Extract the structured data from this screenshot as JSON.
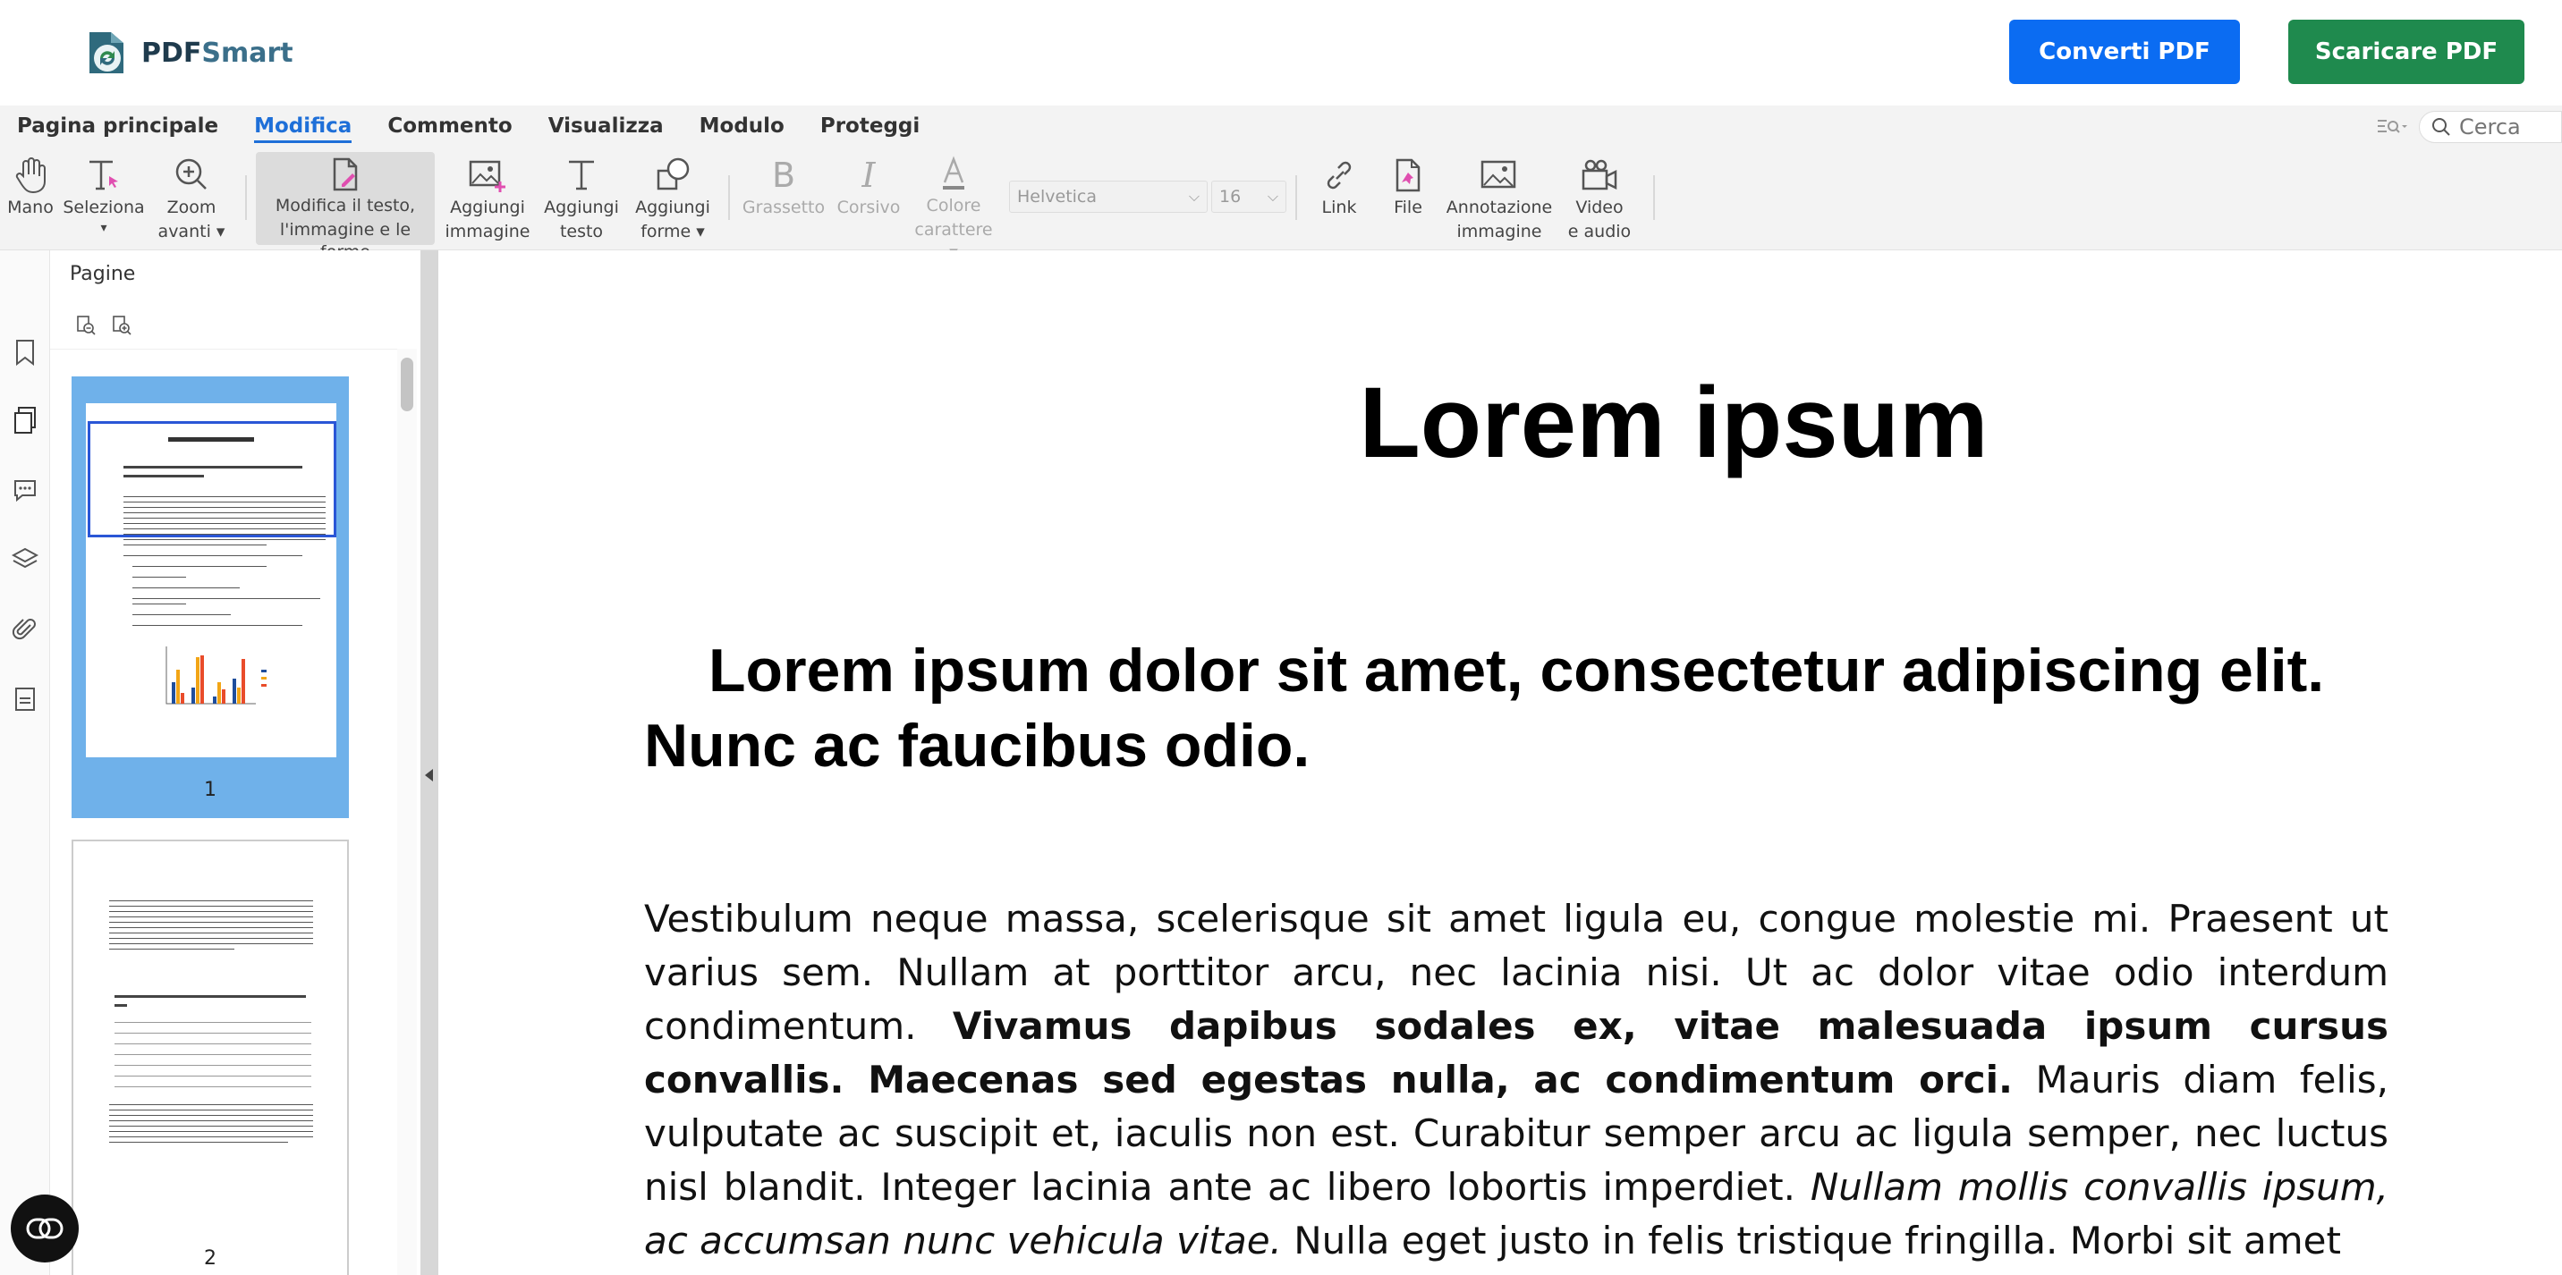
{
  "app": {
    "logo_pdf": "PDF",
    "logo_smart": "Smart"
  },
  "header": {
    "convert_label": "Converti PDF",
    "download_label": "Scaricare PDF"
  },
  "menu": {
    "items": [
      "Pagina principale",
      "Modifica",
      "Commento",
      "Visualizza",
      "Modulo",
      "Proteggi"
    ],
    "active": "Modifica"
  },
  "search": {
    "placeholder": "Cerca"
  },
  "tools": {
    "hand": [
      "Mano",
      ""
    ],
    "select": [
      "Seleziona",
      "▾"
    ],
    "zoom": [
      "Zoom",
      "avanti ▾"
    ],
    "edit": [
      "Modifica il testo,",
      "l'immagine e le forme"
    ],
    "add_image": [
      "Aggiungi",
      "immagine"
    ],
    "add_text": [
      "Aggiungi",
      "testo"
    ],
    "add_shapes": [
      "Aggiungi",
      "forme ▾"
    ],
    "bold": [
      "Grassetto",
      ""
    ],
    "italic": [
      "Corsivo",
      ""
    ],
    "color": [
      "Colore",
      "carattere ▾"
    ],
    "font_family": "Helvetica",
    "font_size": "16",
    "link": [
      "Link",
      ""
    ],
    "file": [
      "File",
      ""
    ],
    "image_annotation": [
      "Annotazione",
      "immagine"
    ],
    "video_audio": [
      "Video",
      "e audio"
    ]
  },
  "pages_panel": {
    "title": "Pagine",
    "page1_num": "1",
    "page2_num": "2"
  },
  "document": {
    "title": "Lorem ipsum",
    "subtitle": "Lorem ipsum dolor sit amet, consectetur adipiscing elit. Nunc ac faucibus odio.",
    "body_1": "Vestibulum neque massa, scelerisque sit amet ligula eu, congue molestie mi. Praesent ut varius sem. Nullam at porttitor arcu, nec lacinia nisi. Ut ac dolor vitae odio interdum condimentum. ",
    "body_bold": "Vivamus dapibus sodales ex, vitae malesuada ipsum cursus convallis. Maecenas sed egestas nulla, ac condimentum orci.",
    "body_2": " Mauris diam felis, vulputate ac suscipit et, iaculis non est. Curabitur semper arcu ac ligula semper, nec luctus nisl blandit. Integer lacinia ante ac libero lobortis imperdiet. ",
    "body_italic": "Nullam mollis convallis ipsum, ac accumsan nunc vehicula vitae.",
    "body_3": " Nulla eget justo in felis tristique fringilla. Morbi sit amet"
  },
  "colors": {
    "convert": "#0b6cf2",
    "download": "#1f8a4e",
    "accent": "#1e6fd8",
    "page_selected": "#6fb1ea"
  }
}
